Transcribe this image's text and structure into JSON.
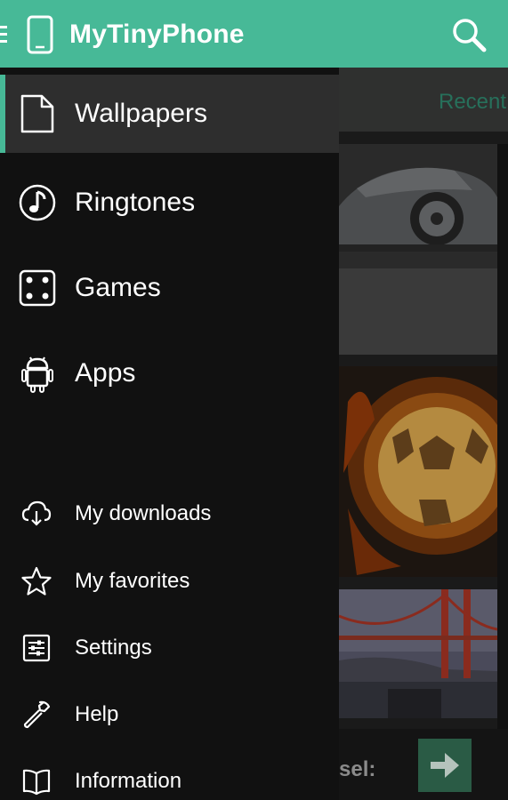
{
  "app": {
    "title": "MyTinyPhone"
  },
  "drawer": {
    "main_items": [
      {
        "label": "Wallpapers",
        "icon": "document-icon",
        "active": true
      },
      {
        "label": "Ringtones",
        "icon": "music-note-icon"
      },
      {
        "label": "Games",
        "icon": "dice-icon"
      },
      {
        "label": "Apps",
        "icon": "android-icon"
      }
    ],
    "secondary_items": [
      {
        "label": "My downloads",
        "icon": "cloud-download-icon"
      },
      {
        "label": "My favorites",
        "icon": "star-icon"
      },
      {
        "label": "Settings",
        "icon": "sliders-icon"
      },
      {
        "label": "Help",
        "icon": "wrench-icon"
      },
      {
        "label": "Information",
        "icon": "book-icon"
      }
    ]
  },
  "background": {
    "tab_label": "Recent",
    "bottom_label": "sel:",
    "next_icon": "arrow-right-icon"
  },
  "colors": {
    "accent": "#47b997",
    "drawer_bg": "#111111",
    "active_item_bg": "#2e2e2e"
  }
}
